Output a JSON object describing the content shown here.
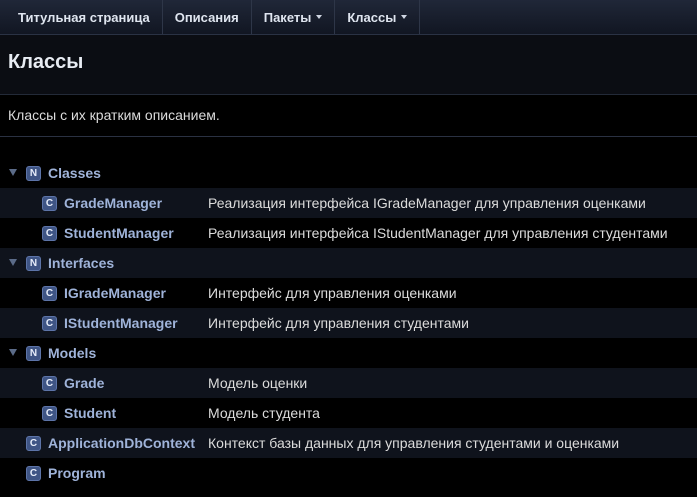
{
  "nav": {
    "items": [
      {
        "label": "Титульная страница"
      },
      {
        "label": "Описания"
      },
      {
        "label": "Пакеты"
      },
      {
        "label": "Классы"
      }
    ]
  },
  "header": {
    "title": "Классы"
  },
  "description": "Классы с их кратким описанием.",
  "tree": {
    "namespace_badge": "N",
    "class_badge": "C",
    "rows": [
      {
        "type": "namespace",
        "name": "Classes",
        "desc": ""
      },
      {
        "type": "class",
        "name": "GradeManager",
        "desc": "Реализация интерфейса IGradeManager для управления оценками"
      },
      {
        "type": "class",
        "name": "StudentManager",
        "desc": "Реализация интерфейса IStudentManager для управления студентами"
      },
      {
        "type": "namespace",
        "name": "Interfaces",
        "desc": ""
      },
      {
        "type": "class",
        "name": "IGradeManager",
        "desc": "Интерфейс для управления оценками"
      },
      {
        "type": "class",
        "name": "IStudentManager",
        "desc": "Интерфейс для управления студентами"
      },
      {
        "type": "namespace",
        "name": "Models",
        "desc": ""
      },
      {
        "type": "class",
        "name": "Grade",
        "desc": "Модель оценки"
      },
      {
        "type": "class",
        "name": "Student",
        "desc": "Модель студента"
      },
      {
        "type": "class",
        "name": "ApplicationDbContext",
        "desc": "Контекст базы данных для управления студентами и оценками"
      },
      {
        "type": "class",
        "name": "Program",
        "desc": ""
      }
    ]
  },
  "colors": {
    "background": "#000000",
    "link": "#9fb3d9",
    "badge": "#3f5585",
    "row_alt": "#0f131c"
  }
}
